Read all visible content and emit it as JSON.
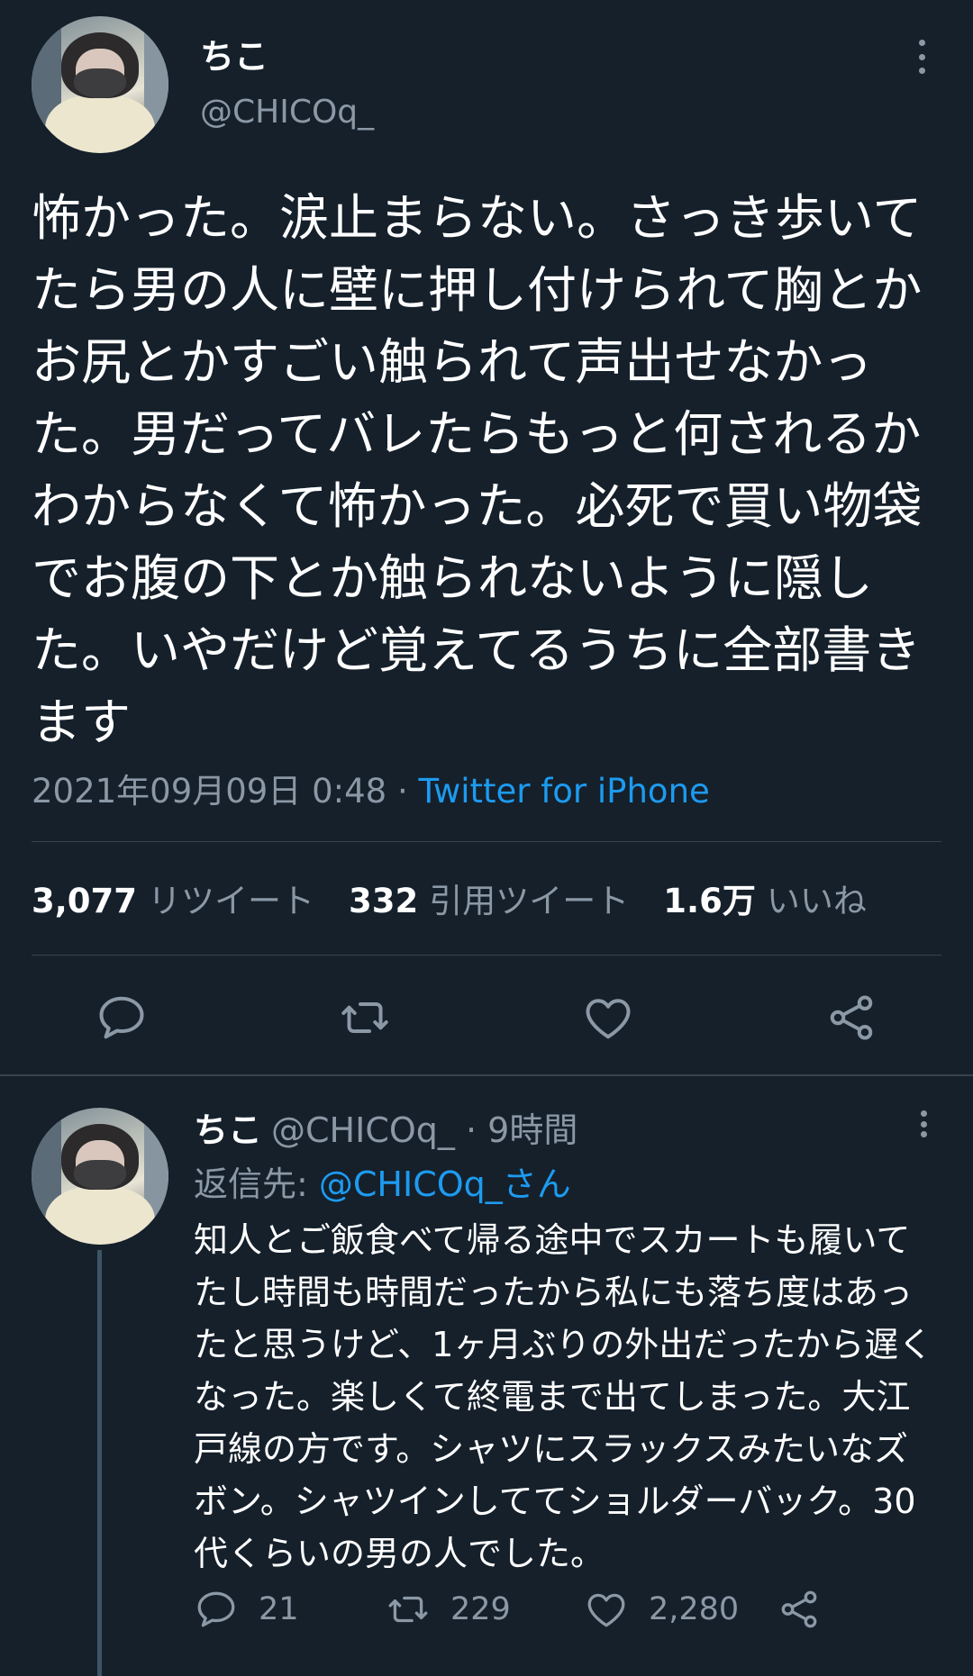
{
  "colors": {
    "background": "#15202b",
    "text": "#ffffff",
    "secondary": "#8b98a5",
    "link": "#1d9bf0",
    "divider": "#38444d"
  },
  "main_tweet": {
    "display_name": "ちこ",
    "handle": "@CHICOq_",
    "text": "怖かった。涙止まらない。さっき歩いてたら男の人に壁に押し付けられて胸とかお尻とかすごい触られて声出せなかった。男だってバレたらもっと何されるかわからなくて怖かった。必死で買い物袋でお腹の下とか触られないように隠した。いやだけど覚えてるうちに全部書きます",
    "timestamp": "2021年09月09日 0:48",
    "separator": " · ",
    "source": "Twitter for iPhone",
    "stats": {
      "retweets_count": "3,077",
      "retweets_label": "リツイート",
      "quotes_count": "332",
      "quotes_label": "引用ツイート",
      "likes_count": "1.6万",
      "likes_label": "いいね"
    },
    "actions": [
      "reply-icon",
      "retweet-icon",
      "like-icon",
      "share-icon"
    ]
  },
  "reply_tweet": {
    "display_name": "ちこ",
    "handle": "@CHICOq_",
    "time": "9時間",
    "time_separator": " · ",
    "replying_to_label": "返信先: ",
    "replying_to_mention": "@CHICOq_さん",
    "text": "知人とご飯食べて帰る途中でスカートも履いてたし時間も時間だったから私にも落ち度はあったと思うけど、1ヶ月ぶりの外出だったから遅くなった。楽しくて終電まで出てしまった。大江戸線の方です。シャツにスラックスみたいなズボン。シャツインしててショルダーバック。30代くらいの男の人でした。",
    "replies_count": "21",
    "retweets_count": "229",
    "likes_count": "2,280"
  }
}
